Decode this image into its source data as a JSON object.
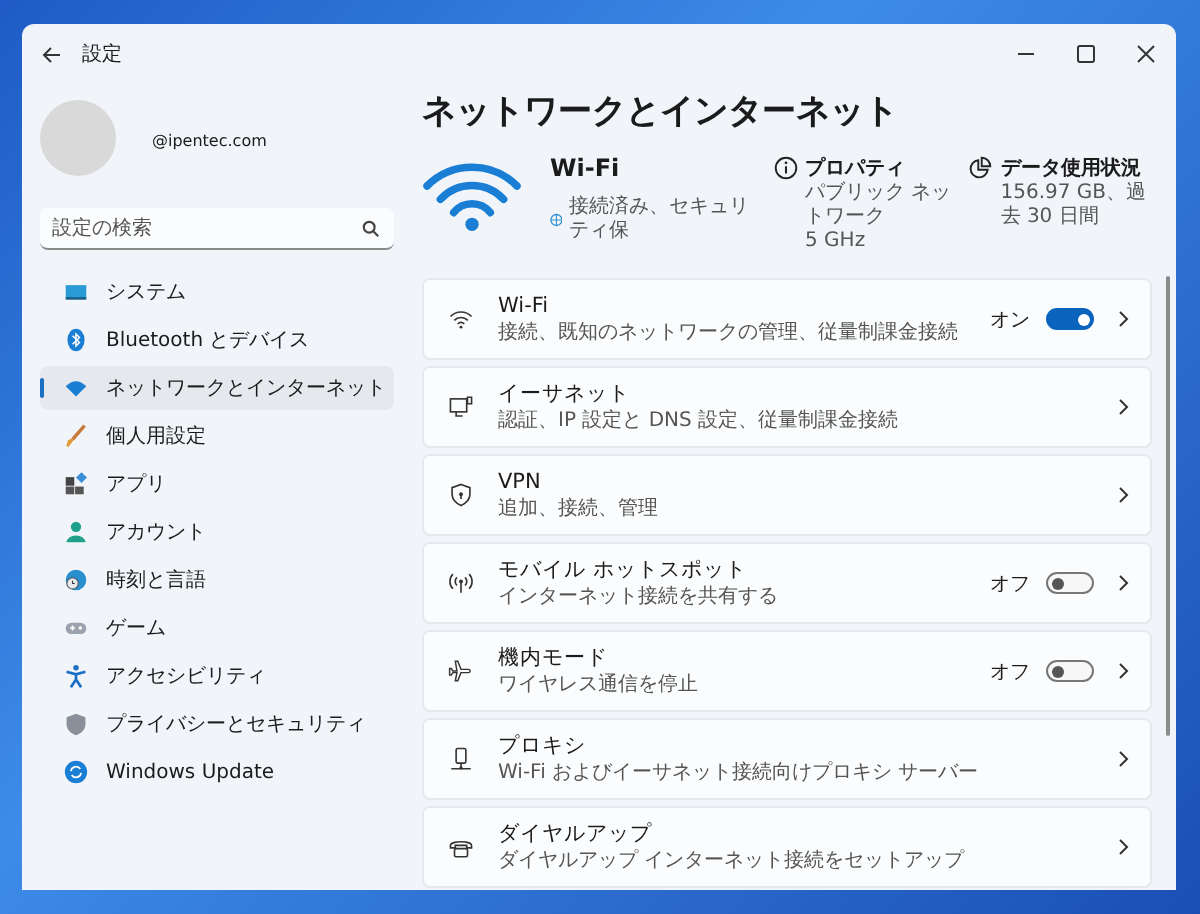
{
  "window": {
    "title": "設定"
  },
  "profile": {
    "email": "@ipentec.com"
  },
  "search": {
    "placeholder": "設定の検索"
  },
  "sidebar": {
    "items": [
      {
        "label": "システム",
        "selected": false
      },
      {
        "label": "Bluetooth とデバイス",
        "selected": false
      },
      {
        "label": "ネットワークとインターネット",
        "selected": true
      },
      {
        "label": "個人用設定",
        "selected": false
      },
      {
        "label": "アプリ",
        "selected": false
      },
      {
        "label": "アカウント",
        "selected": false
      },
      {
        "label": "時刻と言語",
        "selected": false
      },
      {
        "label": "ゲーム",
        "selected": false
      },
      {
        "label": "アクセシビリティ",
        "selected": false
      },
      {
        "label": "プライバシーとセキュリティ",
        "selected": false
      },
      {
        "label": "Windows Update",
        "selected": false
      }
    ]
  },
  "page_title": "ネットワークとインターネット",
  "hero": {
    "name": "Wi-Fi",
    "status": "接続済み、セキュリティ保",
    "properties": {
      "title": "プロパティ",
      "lines": [
        "パブリック ネットワーク",
        "5 GHz"
      ]
    },
    "data_usage": {
      "title": "データ使用状況",
      "detail": "156.97 GB、過去 30 日間"
    }
  },
  "rows": [
    {
      "kind": "toggle",
      "title": "Wi-Fi",
      "subtitle": "接続、既知のネットワークの管理、従量制課金接続",
      "state_label": "オン",
      "on": true
    },
    {
      "kind": "link",
      "title": "イーサネット",
      "subtitle": "認証、IP 設定と DNS 設定、従量制課金接続"
    },
    {
      "kind": "link",
      "title": "VPN",
      "subtitle": "追加、接続、管理"
    },
    {
      "kind": "toggle",
      "title": "モバイル ホットスポット",
      "subtitle": "インターネット接続を共有する",
      "state_label": "オフ",
      "on": false
    },
    {
      "kind": "toggle",
      "title": "機内モード",
      "subtitle": "ワイヤレス通信を停止",
      "state_label": "オフ",
      "on": false
    },
    {
      "kind": "link",
      "title": "プロキシ",
      "subtitle": "Wi-Fi およびイーサネット接続向けプロキシ サーバー"
    },
    {
      "kind": "link",
      "title": "ダイヤルアップ",
      "subtitle": "ダイヤルアップ インターネット接続をセットアップ"
    }
  ]
}
